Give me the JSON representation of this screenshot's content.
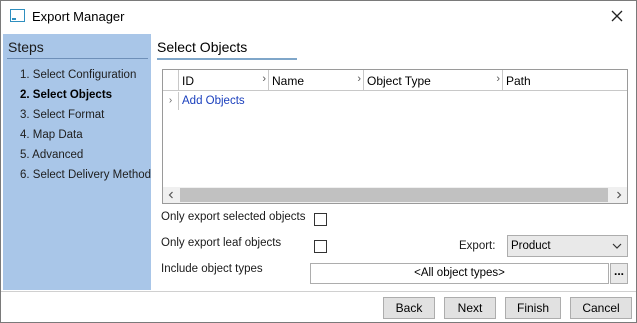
{
  "window": {
    "title": "Export Manager"
  },
  "steps": {
    "title": "Steps",
    "items": [
      {
        "label": "1. Select Configuration",
        "active": false
      },
      {
        "label": "2. Select Objects",
        "active": true
      },
      {
        "label": "3. Select Format",
        "active": false
      },
      {
        "label": "4. Map Data",
        "active": false
      },
      {
        "label": "5. Advanced",
        "active": false
      },
      {
        "label": "6. Select Delivery Method",
        "active": false
      }
    ]
  },
  "main": {
    "title": "Select Objects",
    "grid": {
      "columns": [
        "ID",
        "Name",
        "Object Type",
        "Path"
      ],
      "add_link": "Add Objects"
    },
    "options": {
      "only_selected_label": "Only export selected objects",
      "only_selected_checked": false,
      "only_leaf_label": "Only export leaf objects",
      "only_leaf_checked": false,
      "export_label": "Export:",
      "export_value": "Product",
      "include_types_label": "Include object types",
      "include_types_value": "<All object types>",
      "ellipsis_label": "..."
    }
  },
  "footer": {
    "back": "Back",
    "next": "Next",
    "finish": "Finish",
    "cancel": "Cancel"
  },
  "icons": {
    "app": "window-icon",
    "close": "close-icon",
    "column_expand": "chevron-right-icon",
    "scroll_left": "chevron-left-icon",
    "scroll_right": "chevron-right-icon",
    "dropdown": "chevron-down-icon"
  },
  "colors": {
    "sidebar": "#a9c6e8",
    "link": "#1a3fbd",
    "accent_rule": "#7fa6c9"
  }
}
